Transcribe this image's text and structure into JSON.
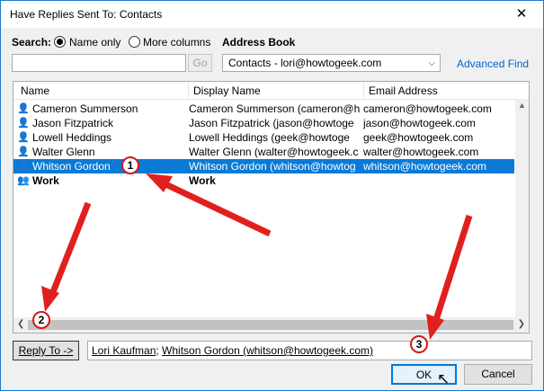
{
  "window": {
    "title": "Have Replies Sent To: Contacts",
    "close": "✕"
  },
  "search": {
    "label": "Search:",
    "name_only": "Name only",
    "more_columns": "More columns",
    "value": "",
    "go": "Go"
  },
  "address_book": {
    "label": "Address Book",
    "selected": "Contacts - lori@howtogeek.com"
  },
  "advanced_find": "Advanced Find",
  "columns": {
    "name": "Name",
    "display": "Display Name",
    "email": "Email Address"
  },
  "rows": [
    {
      "name": "Cameron Summerson",
      "display": "Cameron Summerson (cameron@h",
      "email": "cameron@howtogeek.com"
    },
    {
      "name": "Jason Fitzpatrick",
      "display": "Jason Fitzpatrick (jason@howtoge",
      "email": "jason@howtogeek.com"
    },
    {
      "name": "Lowell Heddings",
      "display": "Lowell Heddings (geek@howtoge",
      "email": "geek@howtogeek.com"
    },
    {
      "name": "Walter Glenn",
      "display": "Walter Glenn (walter@howtogeek.c",
      "email": "walter@howtogeek.com"
    },
    {
      "name": "Whitson Gordon",
      "display": "Whitson Gordon (whitson@howtog",
      "email": "whitson@howtogeek.com"
    },
    {
      "name": "Work",
      "display": "Work",
      "email": ""
    }
  ],
  "reply_to": {
    "button": "Reply To ->",
    "recipient1": "Lori Kaufman",
    "separator": "; ",
    "recipient2": "Whitson Gordon (whitson@howtogeek.com)"
  },
  "ok": "OK",
  "cancel": "Cancel",
  "annotations": [
    "1",
    "2",
    "3"
  ],
  "colors": {
    "selection": "#0a7ad6",
    "arrow": "#e0201e",
    "link": "#0066cc"
  }
}
